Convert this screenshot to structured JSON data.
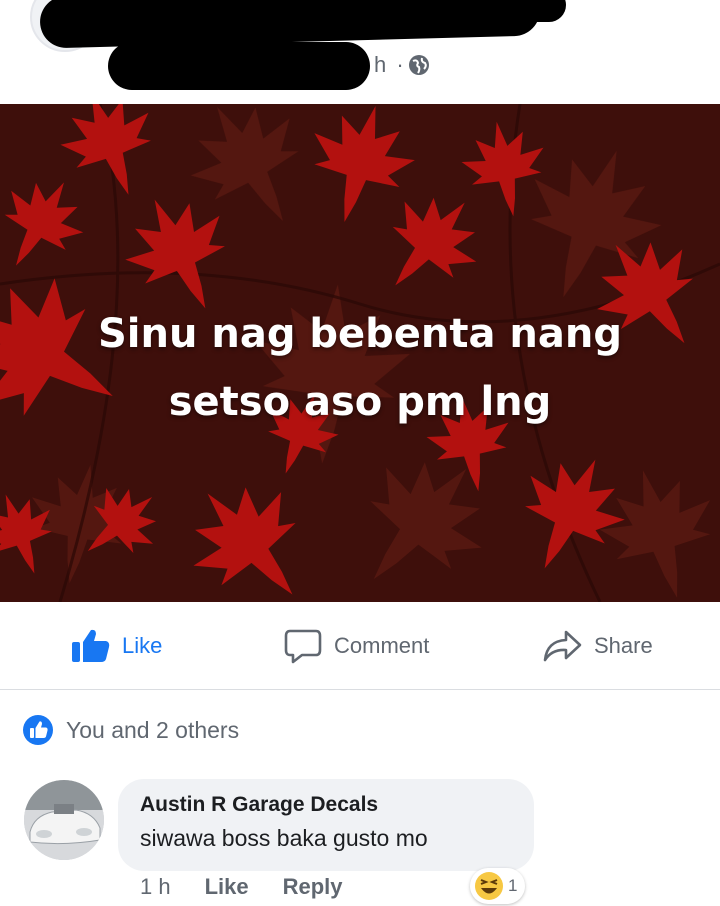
{
  "header": {
    "timestamp_fragment": "h ·"
  },
  "post": {
    "text": "Sinu nag bebenta nang\nsetso  aso pm lng",
    "background": "#3e0f0b",
    "leaf_color": "#b3110f"
  },
  "actions": {
    "like_label": "Like",
    "comment_label": "Comment",
    "share_label": "Share"
  },
  "reactions": {
    "summary": "You and 2 others"
  },
  "comment": {
    "author": "Austin R Garage Decals",
    "text": "siwawa boss baka gusto mo",
    "time": "1 h",
    "like_label": "Like",
    "reply_label": "Reply",
    "reaction_count": "1"
  },
  "colors": {
    "accent": "#1877f2",
    "muted": "#606770",
    "bubble": "#f0f2f5"
  }
}
